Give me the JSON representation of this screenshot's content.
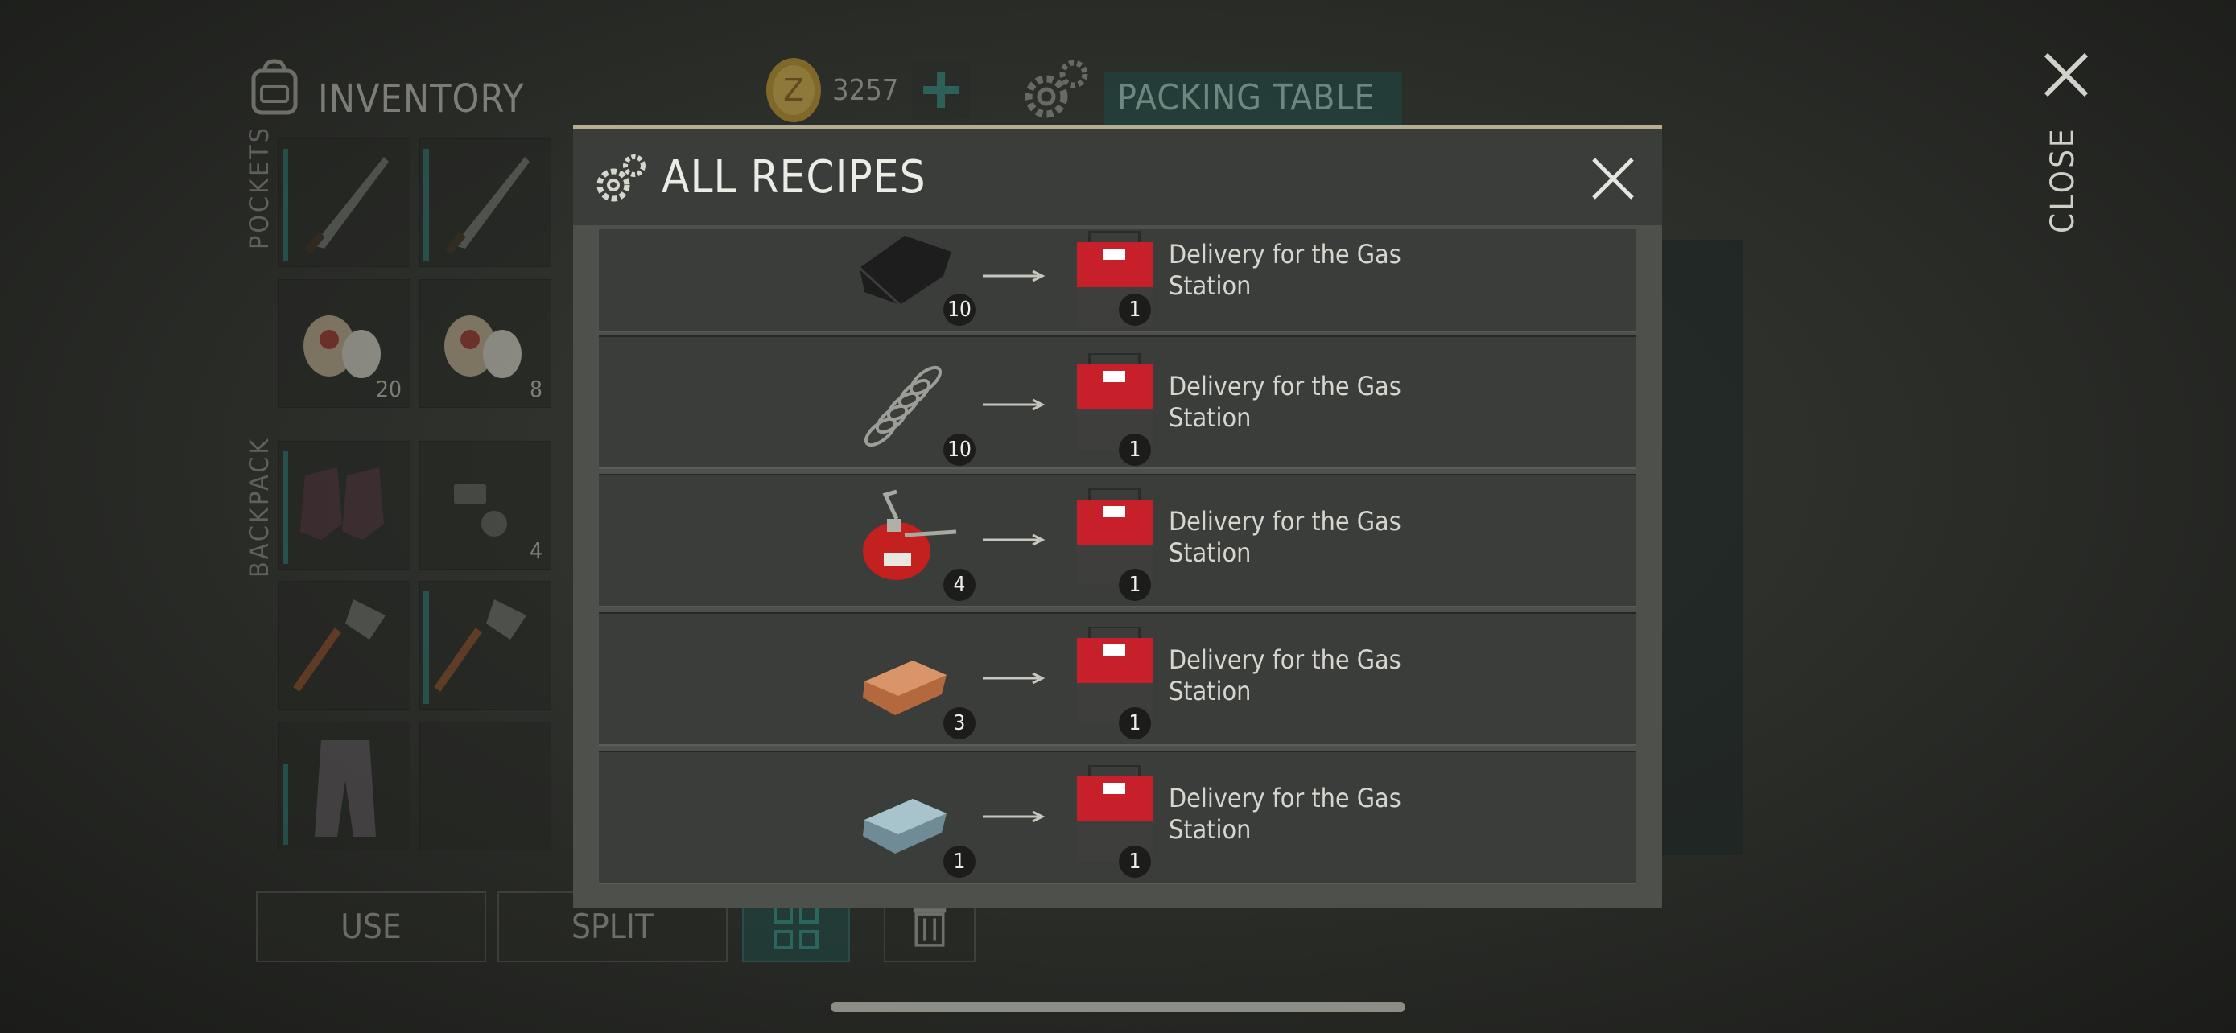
{
  "header": {
    "inventory_title": "INVENTORY",
    "coins": "3257",
    "station_title": "PACKING TABLE",
    "close_label": "CLOSE"
  },
  "sections": {
    "pockets_label": "POCKETS",
    "backpack_label": "BACKPACK"
  },
  "pocket_slots": [
    {
      "item": "machete-icon",
      "count": ""
    },
    {
      "item": "machete-icon",
      "count": ""
    },
    {
      "item": "bandage-icon",
      "count": "20"
    },
    {
      "item": "bandage-icon",
      "count": "8"
    }
  ],
  "backpack_slots": [
    {
      "item": "boots-icon",
      "count": ""
    },
    {
      "item": "bolt-nut-icon",
      "count": "4"
    },
    {
      "item": "shovel-icon",
      "count": ""
    },
    {
      "item": "shovel-icon",
      "count": ""
    },
    {
      "item": "pants-icon",
      "count": ""
    },
    {
      "item": "",
      "count": ""
    }
  ],
  "actions": {
    "use_label": "USE",
    "split_label": "SPLIT"
  },
  "modal": {
    "title": "ALL RECIPES",
    "recipes": [
      {
        "input_icon": "leather-icon",
        "input_count": "10",
        "output_icon": "toolbox-icon",
        "output_count": "1",
        "name": "Delivery for the Gas Station"
      },
      {
        "input_icon": "spring-icon",
        "input_count": "10",
        "output_icon": "toolbox-icon",
        "output_count": "1",
        "name": "Delivery for the Gas Station"
      },
      {
        "input_icon": "oil-can-icon",
        "input_count": "4",
        "output_icon": "toolbox-icon",
        "output_count": "1",
        "name": "Delivery for the Gas Station"
      },
      {
        "input_icon": "copper-ingot-icon",
        "input_count": "3",
        "output_icon": "toolbox-icon",
        "output_count": "1",
        "name": "Delivery for the Gas Station"
      },
      {
        "input_icon": "steel-ingot-icon",
        "input_count": "1",
        "output_icon": "toolbox-icon",
        "output_count": "1",
        "name": "Delivery for the Gas Station"
      }
    ]
  },
  "colors": {
    "accent_teal": "#1f4a44",
    "modal_bg": "#4d504b",
    "row_bg": "#3b3d3a",
    "toolbox_red": "#c8202a"
  }
}
